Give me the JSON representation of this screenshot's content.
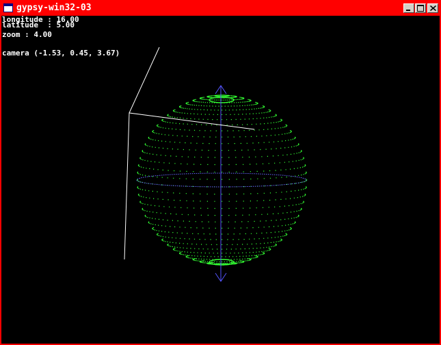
{
  "window": {
    "title": "gypsy-win32-03",
    "titlebar_color": "#ff0000",
    "title_text_color": "#ffffff"
  },
  "hud": {
    "longitude": "longitude : 16.00",
    "latitude": "latitude  : 5.00",
    "zoom": "zoom : 4.00",
    "camera": "camera (-1.53, 0.45, 3.67)"
  },
  "scene": {
    "background": "#000000",
    "sphere_color": "#33ff33",
    "equator_color": "#6666ff",
    "axis_color": "#5555ff",
    "camera_line_color": "#ffffff"
  },
  "icons": {
    "app": "window-app-icon",
    "minimize": "minimize-icon",
    "maximize": "maximize-icon",
    "close": "close-icon"
  }
}
